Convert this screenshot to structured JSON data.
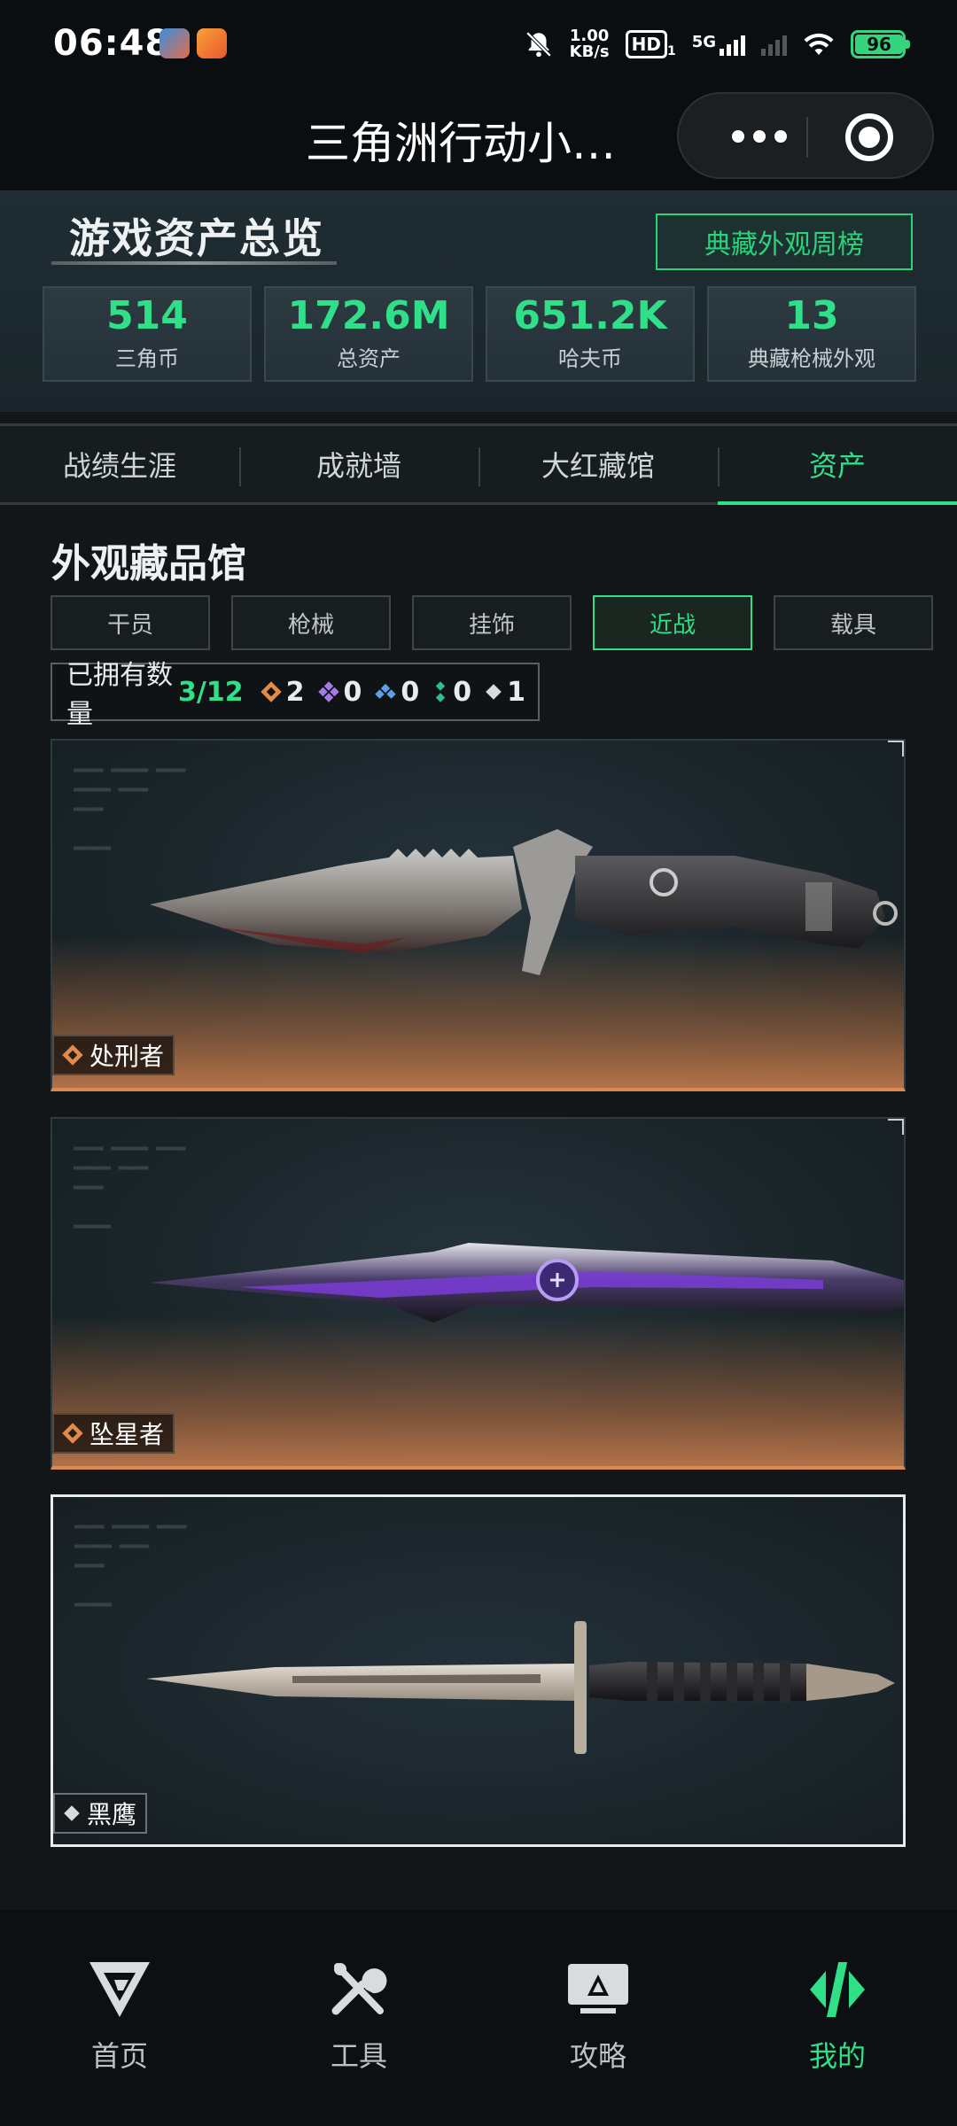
{
  "status_bar": {
    "time": "06:48",
    "net_speed_value": "1.00",
    "net_speed_unit": "KB/s",
    "hd_label": "HD",
    "hd_sub": "1",
    "network": "5G",
    "battery": "96"
  },
  "title_bar": {
    "title": "三角洲行动小…"
  },
  "overview": {
    "title": "游戏资产总览",
    "ranking_button": "典藏外观周榜",
    "stats": [
      {
        "value": "514",
        "label": "三角币"
      },
      {
        "value": "172.6M",
        "label": "总资产"
      },
      {
        "value": "651.2K",
        "label": "哈夫币"
      },
      {
        "value": "13",
        "label": "典藏枪械外观"
      }
    ]
  },
  "tabs": [
    {
      "label": "战绩生涯"
    },
    {
      "label": "成就墙"
    },
    {
      "label": "大红藏馆"
    },
    {
      "label": "资产"
    }
  ],
  "active_tab": "资产",
  "section": {
    "title": "外观藏品馆",
    "chips": [
      {
        "label": "干员"
      },
      {
        "label": "枪械"
      },
      {
        "label": "挂饰"
      },
      {
        "label": "近战"
      },
      {
        "label": "载具"
      }
    ],
    "active_chip": "近战",
    "owned_label": "已拥有数量",
    "owned_ratio": "3/12",
    "rarity_counts": [
      {
        "icon": "orange-diamond-icon",
        "color": "#e38a4a",
        "count": "2"
      },
      {
        "icon": "purple-diamond-icon",
        "color": "#a57ae8",
        "count": "0"
      },
      {
        "icon": "blue-diamond-icon",
        "color": "#5aa3e8",
        "count": "0"
      },
      {
        "icon": "green-diamond-icon",
        "color": "#2fc08a",
        "count": "0"
      },
      {
        "icon": "white-diamond-icon",
        "color": "#d8dcde",
        "count": "1"
      }
    ]
  },
  "items": [
    {
      "name": "处刑者",
      "rarity_color": "#e38a4a"
    },
    {
      "name": "坠星者",
      "rarity_color": "#e38a4a"
    },
    {
      "name": "黑鹰",
      "rarity_color": "#d8dcde"
    }
  ],
  "bottom_nav": [
    {
      "label": "首页",
      "icon": "home-logo-icon"
    },
    {
      "label": "工具",
      "icon": "tools-icon"
    },
    {
      "label": "攻略",
      "icon": "guide-icon"
    },
    {
      "label": "我的",
      "icon": "profile-logo-icon"
    }
  ],
  "colors": {
    "accent": "#2fe088",
    "background": "#121619"
  }
}
